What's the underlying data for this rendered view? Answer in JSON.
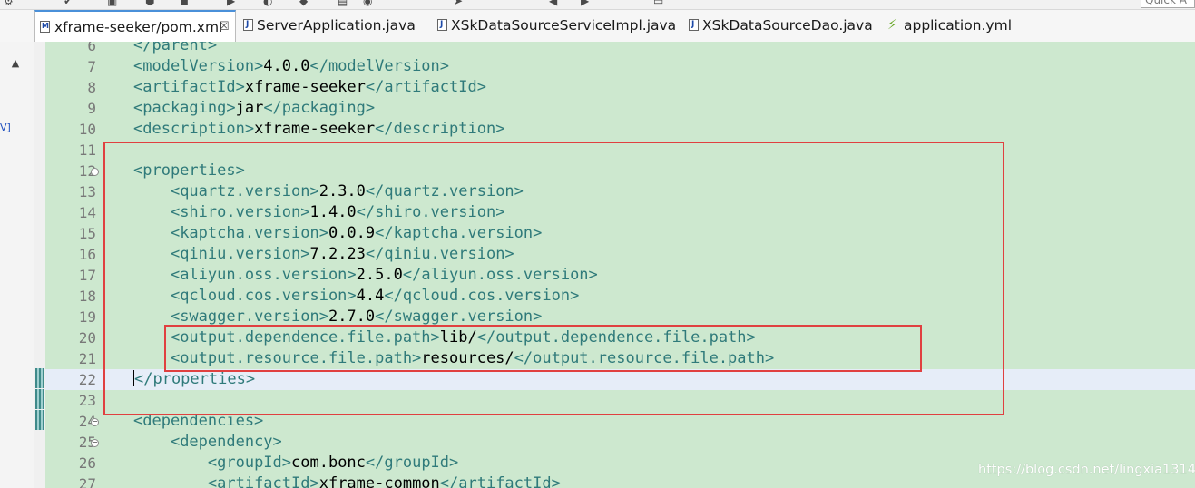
{
  "toolbar": {
    "quick_access_label": "Quick A",
    "icons": [
      "toolbar-icon",
      "debug-icon",
      "run-icon",
      "build-icon",
      "stop-icon",
      "run-green-icon",
      "profile-icon",
      "external-tools-icon",
      "open-folder-icon",
      "search-icon",
      "nav-arrow-icon",
      "back-icon",
      "forward-icon",
      "open-editor-icon"
    ]
  },
  "tabs": [
    {
      "label": "xframe-seeker/pom.xml",
      "icon": "xml-file-icon",
      "active": true,
      "closable": true
    },
    {
      "label": "ServerApplication.java",
      "icon": "java-file-icon",
      "active": false
    },
    {
      "label": "XSkDataSourceServiceImpl.java",
      "icon": "java-file-icon",
      "active": false
    },
    {
      "label": "XSkDataSourceDao.java",
      "icon": "java-file-icon",
      "active": false
    },
    {
      "label": "application.yml",
      "icon": "yml-file-icon",
      "active": false
    }
  ],
  "close_glyph": "☒",
  "left_panel": {
    "gutter_text": "V]"
  },
  "editor": {
    "colors": {
      "background": "#cde8cf",
      "tag": "#2f7a7a",
      "current_line": "#e6edf8",
      "annotation": "#e04040"
    },
    "lines": [
      {
        "num": "6",
        "indent": "",
        "tag_open": "</parent>",
        "value": "",
        "tag_close": ""
      },
      {
        "num": "7",
        "indent": "",
        "tag_open": "<modelVersion>",
        "value": "4.0.0",
        "tag_close": "</modelVersion>"
      },
      {
        "num": "8",
        "indent": "",
        "tag_open": "<artifactId>",
        "value": "xframe-seeker",
        "tag_close": "</artifactId>"
      },
      {
        "num": "9",
        "indent": "",
        "tag_open": "<packaging>",
        "value": "jar",
        "tag_close": "</packaging>"
      },
      {
        "num": "10",
        "indent": "",
        "tag_open": "<description>",
        "value": "xframe-seeker",
        "tag_close": "</description>"
      },
      {
        "num": "11",
        "indent": "",
        "tag_open": "",
        "value": "",
        "tag_close": ""
      },
      {
        "num": "12",
        "indent": "",
        "tag_open": "<properties>",
        "value": "",
        "tag_close": "",
        "fold": "minus"
      },
      {
        "num": "13",
        "indent": "    ",
        "tag_open": "<quartz.version>",
        "value": "2.3.0",
        "tag_close": "</quartz.version>"
      },
      {
        "num": "14",
        "indent": "    ",
        "tag_open": "<shiro.version>",
        "value": "1.4.0",
        "tag_close": "</shiro.version>"
      },
      {
        "num": "15",
        "indent": "    ",
        "tag_open": "<kaptcha.version>",
        "value": "0.0.9",
        "tag_close": "</kaptcha.version>"
      },
      {
        "num": "16",
        "indent": "    ",
        "tag_open": "<qiniu.version>",
        "value": "7.2.23",
        "tag_close": "</qiniu.version>"
      },
      {
        "num": "17",
        "indent": "    ",
        "tag_open": "<aliyun.oss.version>",
        "value": "2.5.0",
        "tag_close": "</aliyun.oss.version>"
      },
      {
        "num": "18",
        "indent": "    ",
        "tag_open": "<qcloud.cos.version>",
        "value": "4.4",
        "tag_close": "</qcloud.cos.version>"
      },
      {
        "num": "19",
        "indent": "    ",
        "tag_open": "<swagger.version>",
        "value": "2.7.0",
        "tag_close": "</swagger.version>"
      },
      {
        "num": "20",
        "indent": "    ",
        "tag_open": "<output.dependence.file.path>",
        "value": "lib/",
        "tag_close": "</output.dependence.file.path>"
      },
      {
        "num": "21",
        "indent": "    ",
        "tag_open": "<output.resource.file.path>",
        "value": "resources/",
        "tag_close": "</output.resource.file.path>"
      },
      {
        "num": "22",
        "indent": "",
        "tag_open": "",
        "value": "",
        "tag_close": "</properties>",
        "current": true
      },
      {
        "num": "23",
        "indent": "",
        "tag_open": "",
        "value": "",
        "tag_close": ""
      },
      {
        "num": "24",
        "indent": "",
        "tag_open": "<dependencies>",
        "value": "",
        "tag_close": "",
        "fold": "minus"
      },
      {
        "num": "25",
        "indent": "    ",
        "tag_open": "<dependency>",
        "value": "",
        "tag_close": "",
        "fold": "minus"
      },
      {
        "num": "26",
        "indent": "        ",
        "tag_open": "<groupId>",
        "value": "com.bonc",
        "tag_close": "</groupId>"
      },
      {
        "num": "27",
        "indent": "        ",
        "tag_open": "<artifactId>",
        "value": "xframe-common",
        "tag_close": "</artifactId>"
      }
    ]
  },
  "watermark": "https://blog.csdn.net/lingxia1314"
}
